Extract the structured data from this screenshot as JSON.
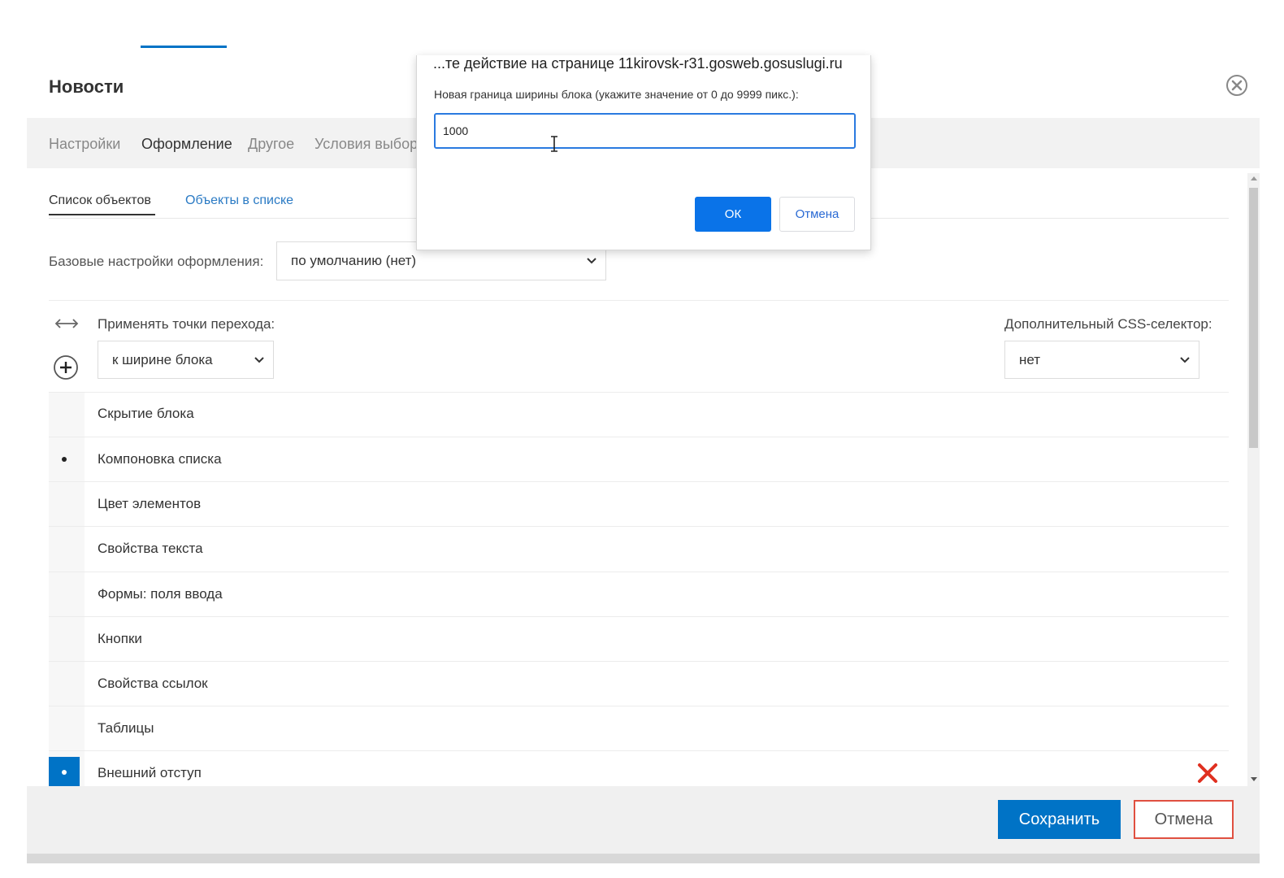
{
  "modal": {
    "title": "Новости",
    "close_icon": "close-circle-icon"
  },
  "tabs": [
    {
      "label": "Настройки",
      "active": false
    },
    {
      "label": "Оформление",
      "active": true
    },
    {
      "label": "Другое",
      "active": false
    },
    {
      "label": "Условия выбор",
      "active": false
    }
  ],
  "subtabs": [
    {
      "label": "Список объектов",
      "active": true
    },
    {
      "label": "Объекты в списке",
      "active": false
    }
  ],
  "base_settings": {
    "label": "Базовые настройки оформления:",
    "value": "по умолчанию (нет)"
  },
  "breakpoints": {
    "label": "Применять точки перехода:",
    "value": "к ширине блока"
  },
  "css_selector": {
    "label": "Дополнительный CSS-селектор:",
    "value": "нет"
  },
  "sections": [
    {
      "label": "Скрытие блока",
      "marker": "none"
    },
    {
      "label": "Компоновка списка",
      "marker": "dot"
    },
    {
      "label": "Цвет элементов",
      "marker": "none"
    },
    {
      "label": "Свойства текста",
      "marker": "none"
    },
    {
      "label": "Формы: поля ввода",
      "marker": "none"
    },
    {
      "label": "Кнопки",
      "marker": "none"
    },
    {
      "label": "Свойства ссылок",
      "marker": "none"
    },
    {
      "label": "Таблицы",
      "marker": "none"
    },
    {
      "label": "Внешний отступ",
      "marker": "active"
    }
  ],
  "footer": {
    "save_label": "Сохранить",
    "cancel_label": "Отмена"
  },
  "prompt": {
    "title": "...те действие на странице 11kirovsk-r31.gosweb.gosuslugi.ru",
    "message": "Новая граница ширины блока (укажите значение от 0 до 9999 пикс.):",
    "input_value": "1000",
    "ok_label": "ОК",
    "cancel_label": "Отмена"
  },
  "colors": {
    "accent": "#0073c6",
    "danger": "#e03020"
  }
}
